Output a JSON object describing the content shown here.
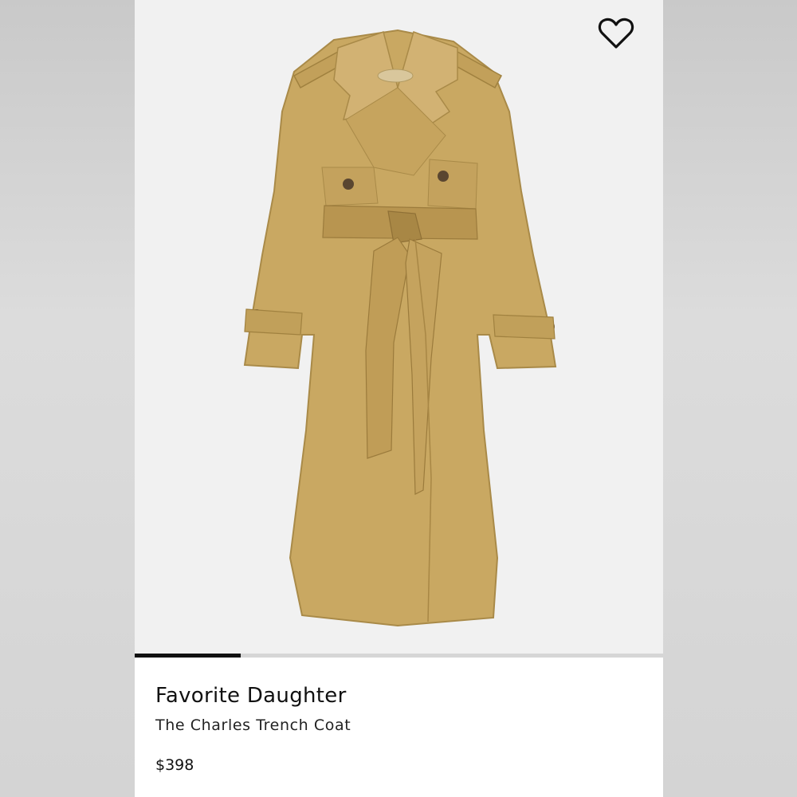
{
  "product": {
    "brand": "Favorite Daughter",
    "name": "The Charles Trench Coat",
    "price": "$398",
    "image_subject": "tan belted trench coat"
  },
  "gallery": {
    "image_count_shown": 1,
    "progress_fraction": 0.2
  },
  "icons": {
    "favorite": "heart-outline-icon"
  },
  "colors": {
    "coat": "#c9a862",
    "coat_shadow": "#a98a48",
    "coat_highlight": "#d6b878",
    "button": "#5a4630",
    "progress_fill": "#111111",
    "progress_track": "#d6d6d6"
  }
}
